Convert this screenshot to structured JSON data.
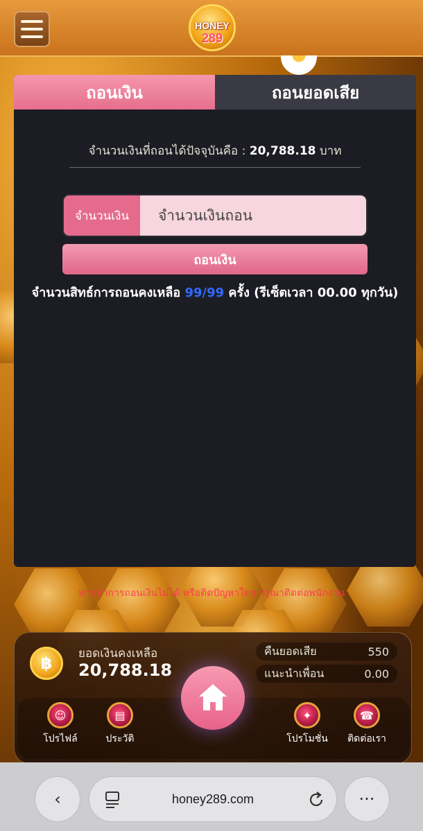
{
  "header": {
    "logo_text_top": "HONEY",
    "logo_text_bottom": "289"
  },
  "tabs": [
    {
      "label": "ถอนเงิน",
      "active": true
    },
    {
      "label": "ถอนยอดเสีย",
      "active": false
    }
  ],
  "withdraw": {
    "available_prefix": "จำนวนเงินที่ถอนได้ปัจจุบันคือ : ",
    "available_amount": "20,788.18",
    "available_unit": " บาท",
    "amount_label": "จำนวนเงิน",
    "amount_placeholder": "จำนวนเงินถอน",
    "button_label": "ถอนเงิน",
    "quota_prefix": "จำนวนสิทธ์การถอนคงเหลือ ",
    "quota_count": "99/99",
    "quota_suffix": " ครั้ง (รีเซ็ตเวลา 00.00 ทุกวัน)"
  },
  "warning_text": "หากทำการถอนเงินไม่ได้ หรือติดปัญหาใดๆ กรุณาติดต่อพนักงาน",
  "balance": {
    "label": "ยอดเงินคงเหลือ",
    "value": "20,788.18",
    "coin_symbol": "฿"
  },
  "side_stats": [
    {
      "label": "คืนยอดเสีย",
      "value": "550"
    },
    {
      "label": "แนะนำเพื่อน",
      "value": "0.00"
    }
  ],
  "nav": [
    {
      "label": "โปรไฟล์",
      "icon": "profile-icon"
    },
    {
      "label": "ประวัติ",
      "icon": "history-icon"
    },
    {
      "label": "โปรโมชั่น",
      "icon": "promotion-icon"
    },
    {
      "label": "ติดต่อเรา",
      "icon": "contact-icon"
    }
  ],
  "browser": {
    "url": "honey289.com"
  },
  "colors": {
    "accent_pink": "#e66f8c",
    "panel_bg": "#1c1c24",
    "quota_highlight": "#2f6bff",
    "warning": "#ff3355"
  }
}
